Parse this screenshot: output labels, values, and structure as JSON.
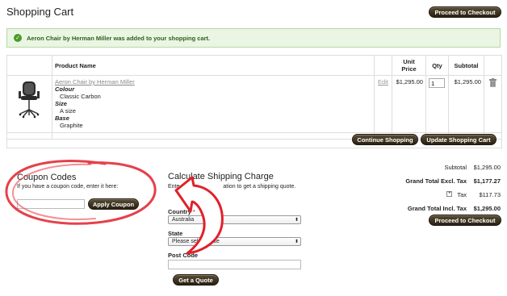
{
  "page": {
    "title": "Shopping Cart"
  },
  "header": {
    "checkout_button": "Proceed to Checkout"
  },
  "message": {
    "text": "Aeron Chair by Herman Miller was added to your shopping cart."
  },
  "cart": {
    "columns": [
      "Product Name",
      "Unit Price",
      "Qty",
      "Subtotal"
    ],
    "item": {
      "name": "Aeron Chair by Herman Miller",
      "options": [
        {
          "label": "Colour",
          "value": "Classic Carbon"
        },
        {
          "label": "Size",
          "value": "A size"
        },
        {
          "label": "Base",
          "value": "Graphite"
        }
      ],
      "edit": "Edit",
      "unit_price": "$1,295.00",
      "qty": "1",
      "subtotal": "$1,295.00"
    },
    "continue_button": "Continue Shopping",
    "update_button": "Update Shopping Cart"
  },
  "coupon": {
    "title": "Coupon Codes",
    "hint": "If you have a coupon code, enter it here:",
    "value": "",
    "apply_button": "Apply Coupon"
  },
  "shipping": {
    "title": "Calculate Shipping Charge",
    "hint_start": "Ente",
    "hint_end": "ation to get a shipping quote.",
    "country_label": "Country",
    "required_mark": "*",
    "country_value": "Australia",
    "state_label": "State",
    "state_value": "Please select state",
    "postcode_label": "Post Code",
    "postcode_value": "",
    "quote_button": "Get a Quote"
  },
  "totals": {
    "subtotal_label": "Subtotal",
    "subtotal_value": "$1,295.00",
    "excl_label": "Grand Total Excl. Tax",
    "excl_value": "$1,177.27",
    "tax_label": "Tax",
    "tax_value": "$117.73",
    "incl_label": "Grand Total Incl. Tax",
    "incl_value": "$1,295.00",
    "checkout_button": "Proceed to Checkout"
  },
  "colors": {
    "annotation": "#e0202a",
    "button": "#3a2f1c",
    "success_bg": "#eaf6e3"
  },
  "icons": [
    "check-icon",
    "trash-icon",
    "plus-icon",
    "dropdown-arrow-icon"
  ]
}
